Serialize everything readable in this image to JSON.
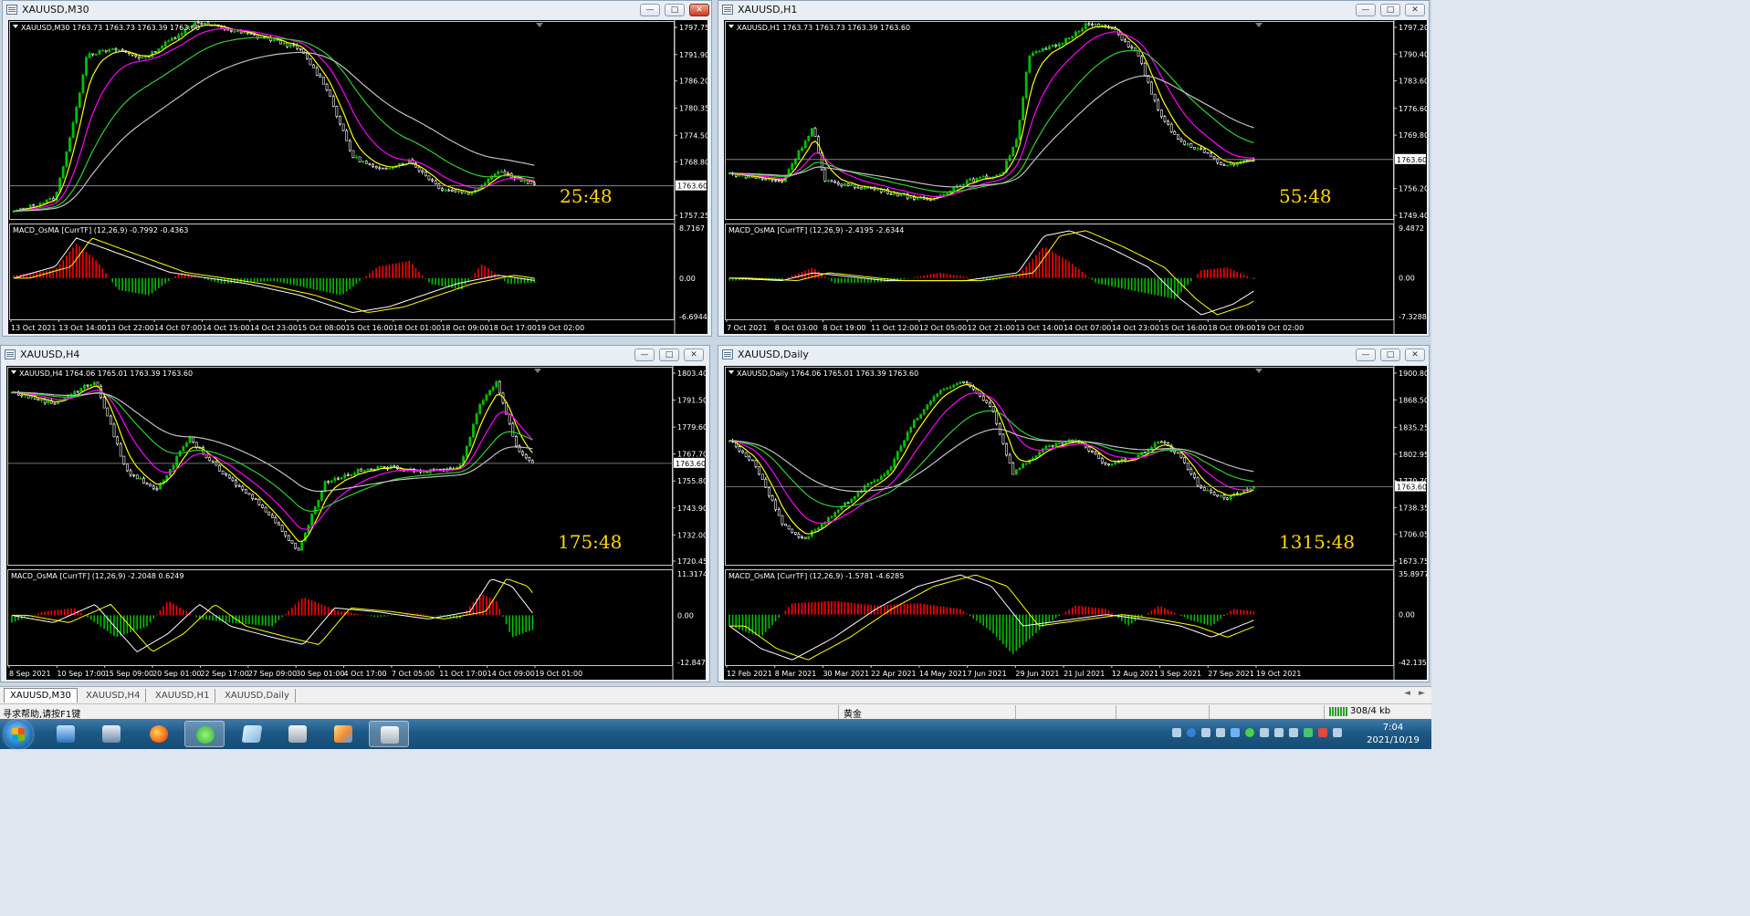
{
  "colors": {
    "bull_candle": "#00c000",
    "bear_candle": "#ffffff",
    "ma_yellow": "#ffff00",
    "ma_magenta": "#ff00ff",
    "ma_green": "#32cd32",
    "ma_gray": "#c0c0c0",
    "hist_pos": "#ff0000",
    "hist_neg": "#00c000",
    "countdown": "#ffd700",
    "price_axis_text": "#ffffff"
  },
  "windows": [
    {
      "id": "m30",
      "title": "XAUUSD,M30",
      "active": true,
      "info": "XAUUSD,M30  1763.73 1763.73 1763.39 1763.60",
      "countdown": "25:48",
      "current_price": "1763.60",
      "price_ticks": [
        "1797.75",
        "1791.90",
        "1786.20",
        "1780.35",
        "1774.50",
        "1768.80",
        "1763.60",
        "1757.25"
      ],
      "macd_label": "MACD_OsMA [CurrTF] (12,26,9) -0.7992 -0.4363",
      "macd_ticks": [
        "8.7167",
        "0.00",
        "-6.6944"
      ],
      "time_labels": [
        "13 Oct 2021",
        "13 Oct 14:00",
        "13 Oct 22:00",
        "14 Oct 07:00",
        "14 Oct 15:00",
        "14 Oct 23:00",
        "15 Oct 08:00",
        "15 Oct 16:00",
        "18 Oct 01:00",
        "18 Oct 09:00",
        "18 Oct 17:00",
        "19 Oct 02:00"
      ],
      "chart_data": {
        "type": "line",
        "price_range": [
          1757.25,
          1797.75
        ],
        "price_path": [
          [
            0,
            1758
          ],
          [
            0.08,
            1761
          ],
          [
            0.12,
            1780
          ],
          [
            0.14,
            1792
          ],
          [
            0.2,
            1793
          ],
          [
            0.25,
            1791
          ],
          [
            0.3,
            1795
          ],
          [
            0.35,
            1799
          ],
          [
            0.42,
            1797
          ],
          [
            0.5,
            1795
          ],
          [
            0.55,
            1793
          ],
          [
            0.6,
            1785
          ],
          [
            0.65,
            1770
          ],
          [
            0.7,
            1767
          ],
          [
            0.76,
            1769
          ],
          [
            0.82,
            1763
          ],
          [
            0.88,
            1762
          ],
          [
            0.93,
            1767
          ],
          [
            1,
            1763.6
          ]
        ],
        "macd_range": [
          -6.6944,
          8.7167
        ],
        "macd_path": [
          [
            0,
            0
          ],
          [
            0.08,
            2
          ],
          [
            0.12,
            7
          ],
          [
            0.18,
            5
          ],
          [
            0.3,
            1
          ],
          [
            0.45,
            -1
          ],
          [
            0.55,
            -3
          ],
          [
            0.65,
            -6
          ],
          [
            0.72,
            -5
          ],
          [
            0.85,
            -1
          ],
          [
            0.93,
            0.5
          ],
          [
            1,
            -0.4
          ]
        ],
        "hist_path": [
          [
            0,
            0.5
          ],
          [
            0.08,
            1.5
          ],
          [
            0.12,
            6
          ],
          [
            0.16,
            3
          ],
          [
            0.2,
            -2
          ],
          [
            0.26,
            -3
          ],
          [
            0.32,
            1
          ],
          [
            0.4,
            -1
          ],
          [
            0.5,
            -0.5
          ],
          [
            0.58,
            -2
          ],
          [
            0.63,
            -3
          ],
          [
            0.7,
            2
          ],
          [
            0.76,
            3
          ],
          [
            0.8,
            -1
          ],
          [
            0.86,
            -2
          ],
          [
            0.9,
            2.5
          ],
          [
            0.95,
            -1
          ],
          [
            1,
            -0.8
          ]
        ]
      }
    },
    {
      "id": "h1",
      "title": "XAUUSD,H1",
      "active": false,
      "info": "XAUUSD,H1  1763.73 1763.73 1763.39 1763.60",
      "countdown": "55:48",
      "current_price": "1763.60",
      "price_ticks": [
        "1797.20",
        "1790.40",
        "1783.60",
        "1776.60",
        "1769.80",
        "1763.60",
        "1756.20",
        "1749.40"
      ],
      "macd_label": "MACD_OsMA [CurrTF] (12,26,9) -2.4195 -2.6344",
      "macd_ticks": [
        "9.4872",
        "0.00",
        "-7.3288"
      ],
      "time_labels": [
        "7 Oct 2021",
        "8 Oct 03:00",
        "8 Oct 19:00",
        "11 Oct 12:00",
        "12 Oct 05:00",
        "12 Oct 21:00",
        "13 Oct 14:00",
        "14 Oct 07:00",
        "14 Oct 23:00",
        "15 Oct 16:00",
        "18 Oct 09:00",
        "19 Oct 02:00"
      ],
      "chart_data": {
        "type": "line",
        "price_range": [
          1749.4,
          1797.2
        ],
        "price_path": [
          [
            0,
            1760
          ],
          [
            0.1,
            1758
          ],
          [
            0.16,
            1772
          ],
          [
            0.18,
            1758
          ],
          [
            0.28,
            1756
          ],
          [
            0.38,
            1753
          ],
          [
            0.45,
            1758
          ],
          [
            0.52,
            1760
          ],
          [
            0.55,
            1770
          ],
          [
            0.57,
            1790
          ],
          [
            0.63,
            1793
          ],
          [
            0.68,
            1798
          ],
          [
            0.73,
            1797
          ],
          [
            0.78,
            1790
          ],
          [
            0.82,
            1775
          ],
          [
            0.86,
            1768
          ],
          [
            0.9,
            1766
          ],
          [
            0.94,
            1762
          ],
          [
            1,
            1763.6
          ]
        ],
        "macd_range": [
          -7.3288,
          9.4872
        ],
        "macd_path": [
          [
            0,
            0
          ],
          [
            0.1,
            -0.5
          ],
          [
            0.16,
            1
          ],
          [
            0.3,
            -0.5
          ],
          [
            0.45,
            -0.5
          ],
          [
            0.55,
            1
          ],
          [
            0.6,
            8
          ],
          [
            0.65,
            9
          ],
          [
            0.72,
            6
          ],
          [
            0.8,
            2
          ],
          [
            0.86,
            -4
          ],
          [
            0.9,
            -7
          ],
          [
            0.96,
            -5
          ],
          [
            1,
            -2.5
          ]
        ],
        "hist_path": [
          [
            0,
            -0.5
          ],
          [
            0.1,
            -0.3
          ],
          [
            0.16,
            2
          ],
          [
            0.2,
            -1
          ],
          [
            0.3,
            -0.8
          ],
          [
            0.4,
            1
          ],
          [
            0.5,
            -0.5
          ],
          [
            0.55,
            0.5
          ],
          [
            0.6,
            6
          ],
          [
            0.65,
            3
          ],
          [
            0.7,
            -1
          ],
          [
            0.75,
            -2
          ],
          [
            0.8,
            -3
          ],
          [
            0.85,
            -4
          ],
          [
            0.9,
            1.5
          ],
          [
            0.95,
            2
          ],
          [
            1,
            -0.2
          ]
        ]
      }
    },
    {
      "id": "h4",
      "title": "XAUUSD,H4",
      "active": false,
      "info": "XAUUSD,H4  1764.06 1765.01 1763.39 1763.60",
      "countdown": "175:48",
      "current_price": "1763.60",
      "price_ticks": [
        "1803.40",
        "1791.50",
        "1779.60",
        "1767.70",
        "1763.60",
        "1755.80",
        "1743.90",
        "1732.00",
        "1720.45"
      ],
      "macd_label": "MACD_OsMA [CurrTF] (12,26,9) -2.2048 0.6249",
      "macd_ticks": [
        "11.3174",
        "0.00",
        "-12.8478"
      ],
      "time_labels": [
        "8 Sep 2021",
        "10 Sep 17:00",
        "15 Sep 09:00",
        "20 Sep 01:00",
        "22 Sep 17:00",
        "27 Sep 09:00",
        "30 Sep 01:00",
        "4 Oct 17:00",
        "7 Oct 05:00",
        "11 Oct 17:00",
        "14 Oct 09:00",
        "19 Oct 01:00"
      ],
      "chart_data": {
        "type": "line",
        "price_range": [
          1720.45,
          1803.4
        ],
        "price_path": [
          [
            0,
            1795
          ],
          [
            0.08,
            1790
          ],
          [
            0.16,
            1800
          ],
          [
            0.22,
            1760
          ],
          [
            0.28,
            1752
          ],
          [
            0.34,
            1775
          ],
          [
            0.4,
            1760
          ],
          [
            0.48,
            1745
          ],
          [
            0.55,
            1725
          ],
          [
            0.6,
            1755
          ],
          [
            0.66,
            1760
          ],
          [
            0.72,
            1762
          ],
          [
            0.8,
            1760
          ],
          [
            0.86,
            1762
          ],
          [
            0.9,
            1790
          ],
          [
            0.93,
            1800
          ],
          [
            0.97,
            1770
          ],
          [
            1,
            1763.6
          ]
        ],
        "macd_range": [
          -12.8478,
          11.3174
        ],
        "macd_path": [
          [
            0,
            0
          ],
          [
            0.08,
            -2
          ],
          [
            0.16,
            3
          ],
          [
            0.24,
            -10
          ],
          [
            0.3,
            -5
          ],
          [
            0.36,
            3
          ],
          [
            0.42,
            -3
          ],
          [
            0.5,
            -6
          ],
          [
            0.56,
            -8
          ],
          [
            0.62,
            2
          ],
          [
            0.7,
            1
          ],
          [
            0.8,
            -1
          ],
          [
            0.88,
            1
          ],
          [
            0.92,
            10
          ],
          [
            0.96,
            8
          ],
          [
            1,
            0.6
          ]
        ],
        "hist_path": [
          [
            0,
            -2
          ],
          [
            0.06,
            1
          ],
          [
            0.12,
            2
          ],
          [
            0.2,
            -6
          ],
          [
            0.26,
            -3
          ],
          [
            0.3,
            4
          ],
          [
            0.36,
            -1
          ],
          [
            0.42,
            -2
          ],
          [
            0.5,
            -3
          ],
          [
            0.56,
            5
          ],
          [
            0.62,
            1.5
          ],
          [
            0.7,
            -0.5
          ],
          [
            0.78,
            0.5
          ],
          [
            0.86,
            -1
          ],
          [
            0.9,
            6
          ],
          [
            0.93,
            4
          ],
          [
            0.96,
            -6
          ],
          [
            1,
            -4
          ]
        ]
      }
    },
    {
      "id": "daily",
      "title": "XAUUSD,Daily",
      "active": false,
      "info": "XAUUSD,Daily  1764.06 1765.01 1763.39 1763.60",
      "countdown": "1315:48",
      "current_price": "1763.60",
      "price_ticks": [
        "1900.80",
        "1868.50",
        "1835.25",
        "1802.95",
        "1770.70",
        "1763.60",
        "1738.35",
        "1706.05",
        "1673.75"
      ],
      "macd_label": "MACD_OsMA [CurrTF] (12,26,9) -1.5781 -4.6285",
      "macd_ticks": [
        "35.8977",
        "0.00",
        "-42.1359"
      ],
      "time_labels": [
        "12 Feb 2021",
        "8 Mar 2021",
        "30 Mar 2021",
        "22 Apr 2021",
        "14 May 2021",
        "7 Jun 2021",
        "29 Jun 2021",
        "21 Jul 2021",
        "12 Aug 2021",
        "3 Sep 2021",
        "27 Sep 2021",
        "19 Oct 2021"
      ],
      "chart_data": {
        "type": "line",
        "price_range": [
          1673.75,
          1900.8
        ],
        "price_path": [
          [
            0,
            1820
          ],
          [
            0.05,
            1790
          ],
          [
            0.1,
            1720
          ],
          [
            0.14,
            1700
          ],
          [
            0.2,
            1730
          ],
          [
            0.25,
            1760
          ],
          [
            0.3,
            1780
          ],
          [
            0.35,
            1840
          ],
          [
            0.4,
            1880
          ],
          [
            0.45,
            1890
          ],
          [
            0.5,
            1860
          ],
          [
            0.54,
            1780
          ],
          [
            0.6,
            1810
          ],
          [
            0.66,
            1820
          ],
          [
            0.72,
            1790
          ],
          [
            0.78,
            1800
          ],
          [
            0.82,
            1820
          ],
          [
            0.86,
            1800
          ],
          [
            0.9,
            1760
          ],
          [
            0.95,
            1750
          ],
          [
            1,
            1763.6
          ]
        ],
        "macd_range": [
          -42.1359,
          35.8977
        ],
        "macd_path": [
          [
            0,
            -10
          ],
          [
            0.06,
            -30
          ],
          [
            0.12,
            -40
          ],
          [
            0.2,
            -20
          ],
          [
            0.28,
            5
          ],
          [
            0.36,
            25
          ],
          [
            0.44,
            35
          ],
          [
            0.5,
            25
          ],
          [
            0.56,
            -10
          ],
          [
            0.64,
            -5
          ],
          [
            0.72,
            0
          ],
          [
            0.8,
            -5
          ],
          [
            0.86,
            -10
          ],
          [
            0.92,
            -20
          ],
          [
            1,
            -5
          ]
        ],
        "hist_path": [
          [
            0,
            -10
          ],
          [
            0.06,
            -20
          ],
          [
            0.12,
            10
          ],
          [
            0.2,
            12
          ],
          [
            0.28,
            8
          ],
          [
            0.36,
            10
          ],
          [
            0.44,
            5
          ],
          [
            0.5,
            -15
          ],
          [
            0.54,
            -35
          ],
          [
            0.6,
            -10
          ],
          [
            0.66,
            8
          ],
          [
            0.72,
            5
          ],
          [
            0.76,
            -10
          ],
          [
            0.82,
            8
          ],
          [
            0.88,
            -5
          ],
          [
            0.92,
            -10
          ],
          [
            0.96,
            5
          ],
          [
            1,
            3
          ]
        ]
      }
    }
  ],
  "tabs": [
    "XAUUSD,M30",
    "XAUUSD,H4",
    "XAUUSD,H1",
    "XAUUSD,Daily"
  ],
  "tab_nav": [
    "◄",
    "►"
  ],
  "status_bar": {
    "help": "寻求帮助,请按F1键",
    "profile": "黄金",
    "traffic": "308/4 kb"
  },
  "clock": {
    "time": "7:04",
    "date": "2021/10/19"
  },
  "taskbar_icons": [
    "start-orb",
    "desktop-icon",
    "computer-icon",
    "firefox-icon",
    "wechat-icon",
    "notes-icon",
    "app-icon",
    "chart-app-icon",
    "terminal-icon"
  ]
}
